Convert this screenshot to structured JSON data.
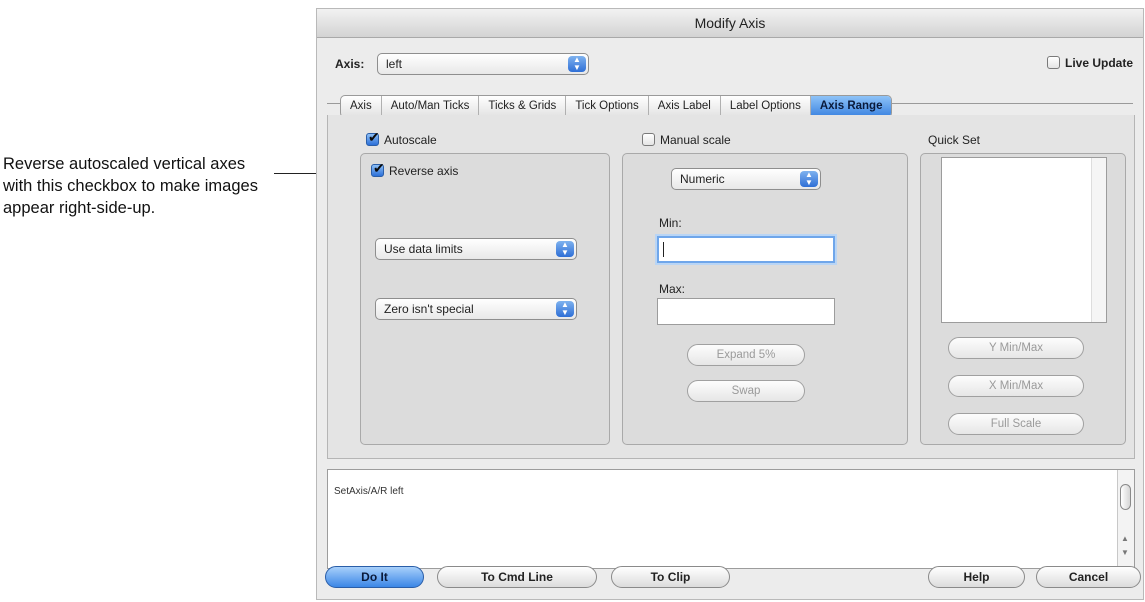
{
  "annotation": {
    "text": "Reverse autoscaled vertical axes with this checkbox to make images appear right-side-up."
  },
  "window": {
    "title": "Modify Axis"
  },
  "axis_selector": {
    "label": "Axis:",
    "value": "left"
  },
  "live_update": {
    "label": "Live Update",
    "checked": false
  },
  "tabs": [
    "Axis",
    "Auto/Man Ticks",
    "Ticks & Grids",
    "Tick Options",
    "Axis Label",
    "Label Options",
    "Axis Range"
  ],
  "active_tab": "Axis Range",
  "autoscale": {
    "label": "Autoscale",
    "checked": true,
    "reverse_axis": {
      "label": "Reverse axis",
      "checked": true
    },
    "limits_popup": "Use data limits",
    "zero_popup": "Zero isn't special"
  },
  "manual_scale": {
    "label": "Manual scale",
    "checked": false,
    "mode_popup": "Numeric",
    "min_label": "Min:",
    "min_value": "",
    "max_label": "Max:",
    "max_value": "",
    "expand_button": "Expand 5%",
    "swap_button": "Swap"
  },
  "quick_set": {
    "label": "Quick Set",
    "buttons": [
      "Y Min/Max",
      "X Min/Max",
      "Full Scale"
    ]
  },
  "command": {
    "text": "SetAxis/A/R left"
  },
  "buttons": {
    "do_it": "Do It",
    "to_cmd_line": "To Cmd Line",
    "to_clip": "To Clip",
    "help": "Help",
    "cancel": "Cancel"
  }
}
